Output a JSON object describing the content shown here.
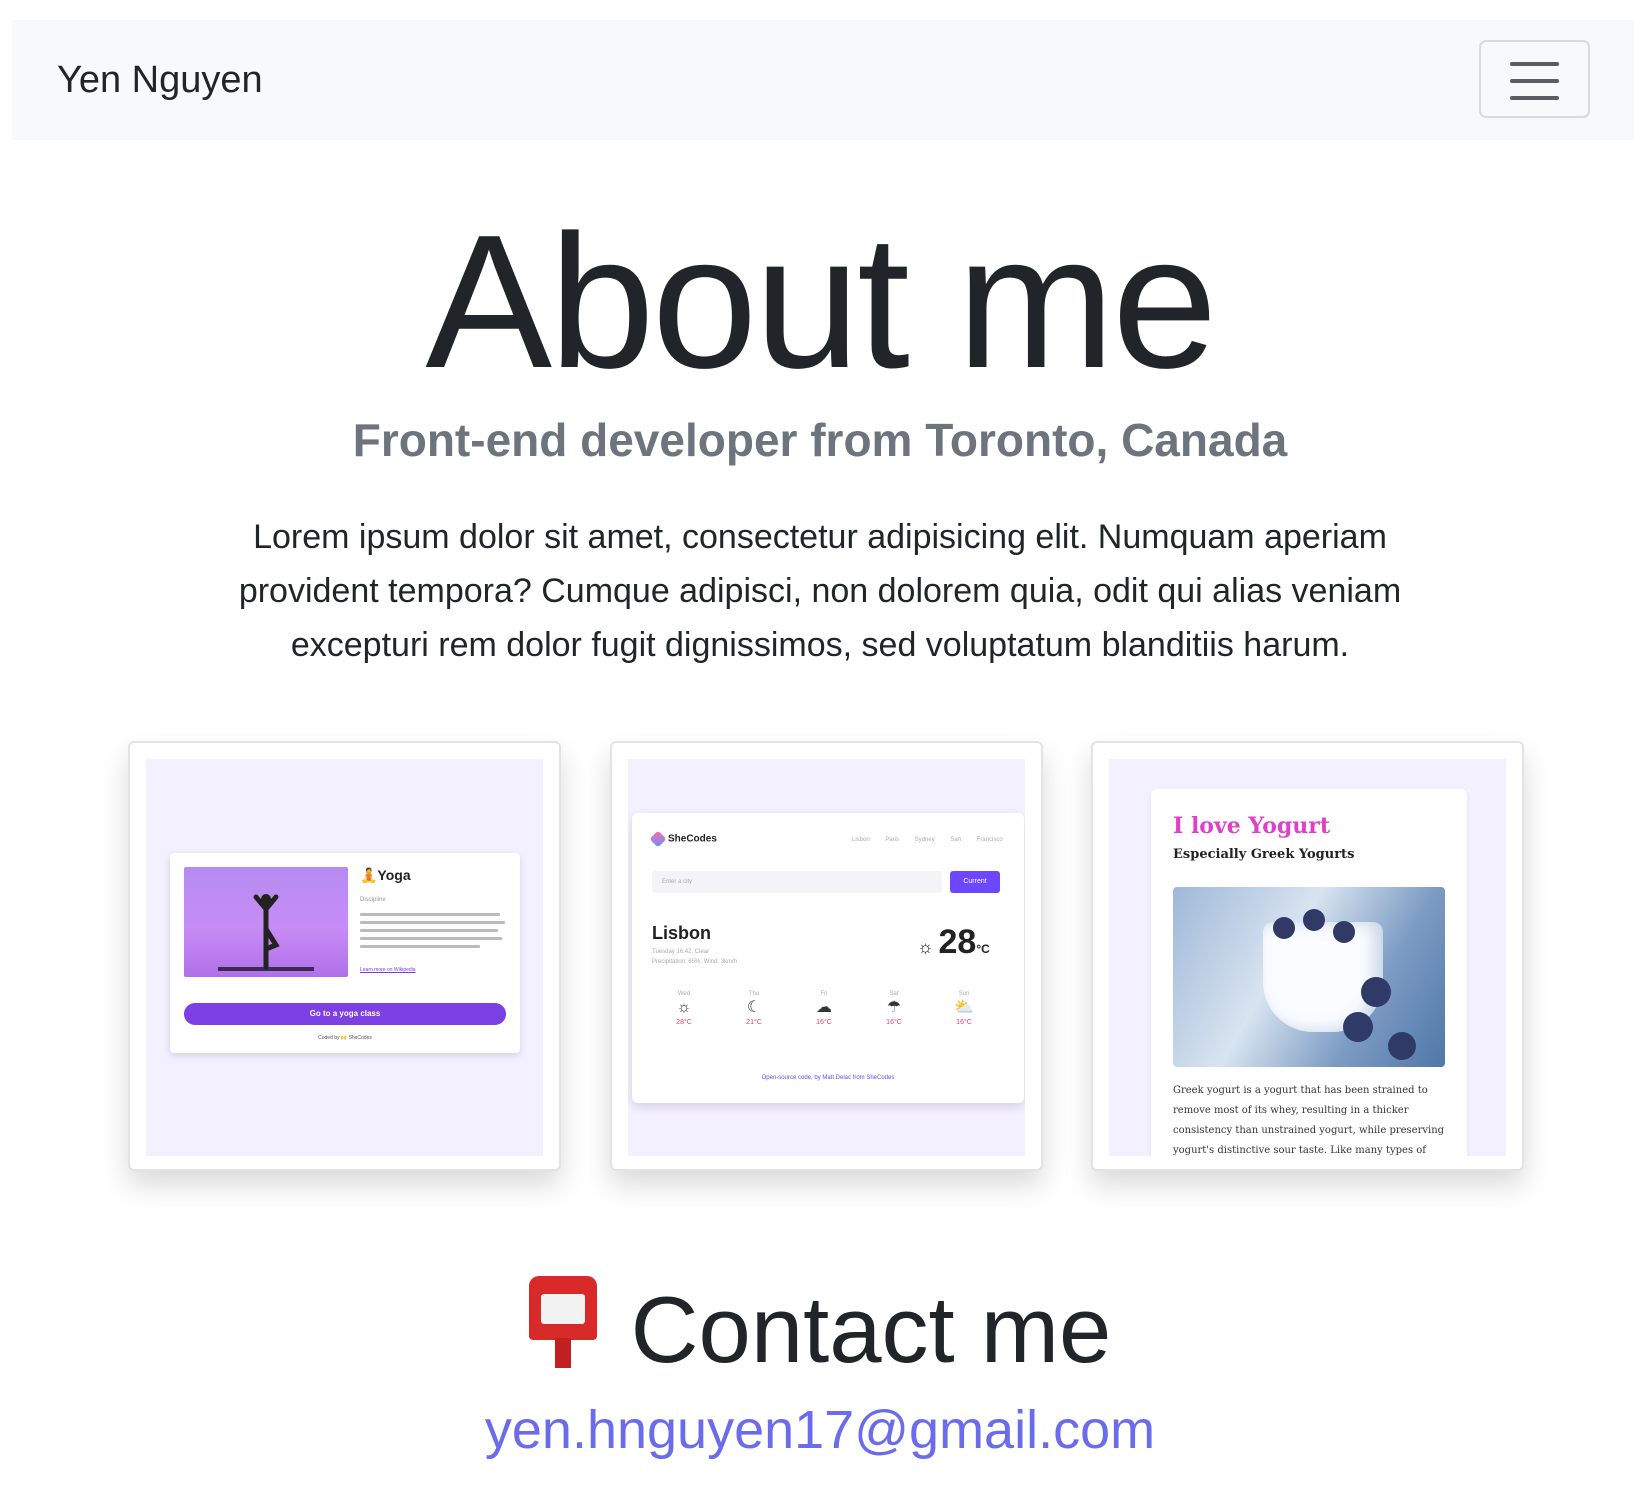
{
  "navbar": {
    "brand": "Yen Nguyen",
    "toggle_icon": "hamburger-menu-icon"
  },
  "hero": {
    "title": "About me",
    "subtitle": "Front-end developer from Toronto, Canada",
    "text": "Lorem ipsum dolor sit amet, consectetur adipisicing elit. Numquam aperiam provident tempora? Cumque adipisci, non dolorem quia, odit qui alias veniam excepturi rem dolor fugit dignissimos, sed voluptatum blanditiis harum."
  },
  "projects": [
    {
      "name": "Yoga",
      "title": "🧘Yoga",
      "discipline": "Discipline",
      "link": "Learn more on Wikipedia",
      "button": "Go to a yoga class",
      "coded_by": "Coded by 🙌 SheCodes"
    },
    {
      "name": "Weather",
      "logo": "SheCodes",
      "tabs": "Lisbon Paris Sydney San Francisco",
      "active_tab": "Lisbon",
      "input_placeholder": "Enter a city",
      "button": "Current",
      "city": "Lisbon",
      "meta_line1": "Tuesday 16:42, Clear",
      "meta_line2": "Precipitation: 65%, Wind: 3km/h",
      "temperature": "28",
      "unit": "°C",
      "forecast": [
        {
          "day": "Wed",
          "icon": "☼",
          "temp": "28°C"
        },
        {
          "day": "Thu",
          "icon": "☾",
          "temp": "21°C"
        },
        {
          "day": "Fri",
          "icon": "☁",
          "temp": "16°C"
        },
        {
          "day": "Sat",
          "icon": "☂",
          "temp": "16°C"
        },
        {
          "day": "Sun",
          "icon": "⛅",
          "temp": "16°C"
        }
      ],
      "footer": "Open-source code, by Matt Delac from SheCodes"
    },
    {
      "name": "Yogurt",
      "title": "I love Yogurt",
      "subtitle": "Especially Greek Yogurts",
      "text": "Greek yogurt is a yogurt that has been strained to remove most of its whey, resulting in a thicker consistency than unstrained yogurt, while preserving yogurt's distinctive sour taste. Like many types of yogurt, strained yogurt is"
    }
  ],
  "contact": {
    "icon": "postbox-icon",
    "title": "Contact me",
    "email": "yen.hnguyen17@gmail.com"
  },
  "colors": {
    "link": "#6b6cec",
    "navbar_bg": "#f8f9fa",
    "subtitle": "#6c757d"
  }
}
